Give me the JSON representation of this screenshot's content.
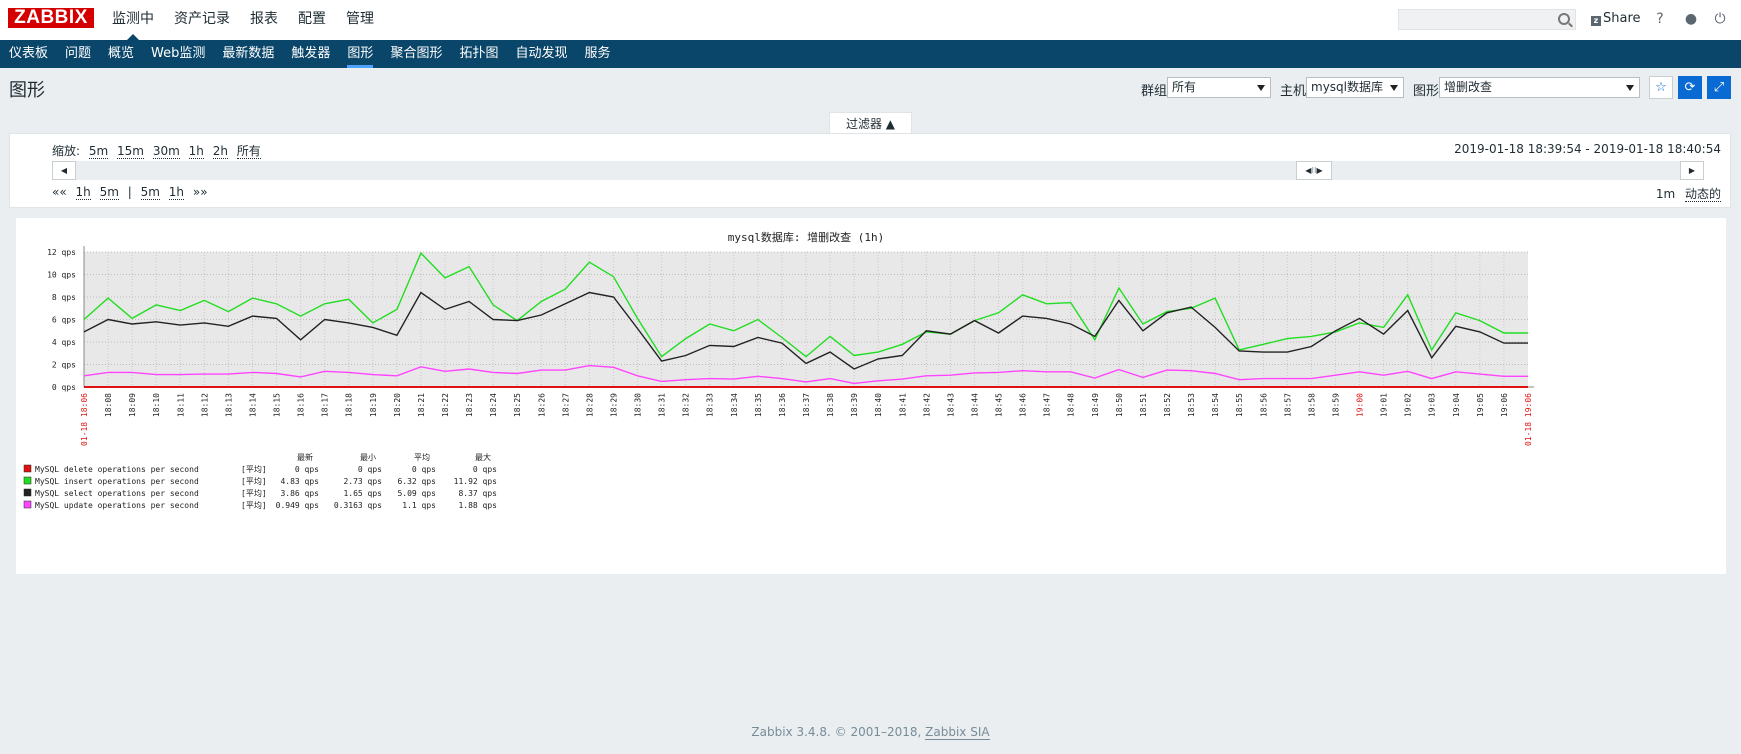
{
  "topbar": {
    "logo": "ZABBIX",
    "menu": [
      "监测中",
      "资产记录",
      "报表",
      "配置",
      "管理"
    ],
    "search_placeholder": "",
    "share_label": "Share",
    "share_icon": "z",
    "help_icon": "?",
    "user_icon": "●",
    "logout_icon": "⏻"
  },
  "mainnav": [
    "仪表板",
    "问题",
    "概览",
    "Web监测",
    "最新数据",
    "触发器",
    "图形",
    "聚合图形",
    "拓扑图",
    "自动发现",
    "服务"
  ],
  "page": {
    "title": "图形",
    "group_label": "群组",
    "group_value": "所有",
    "host_label": "主机",
    "host_value": "mysql数据库",
    "graph_label": "图形",
    "graph_value": "增删改查"
  },
  "filter": {
    "tab_label": "过滤器 ▲",
    "zoom_label": "缩放:",
    "zoom_options": [
      "5m",
      "15m",
      "30m",
      "1h",
      "2h",
      "所有"
    ],
    "range_text": "2019-01-18 18:39:54 - 2019-01-18 18:40:54",
    "back_label": "««",
    "back_options": [
      "1h",
      "5m"
    ],
    "separator": "|",
    "fwd_options": [
      "5m",
      "1h"
    ],
    "fwd_label": "»»",
    "period": "1m",
    "dynamic": "动态的"
  },
  "chart_data": {
    "type": "line",
    "title": "mysql数据库: 增删改查 (1h)",
    "unit": "qps",
    "ylim": [
      0,
      12
    ],
    "yticks": [
      "0 qps",
      "2 qps",
      "4 qps",
      "6 qps",
      "8 qps",
      "10 qps",
      "12 qps"
    ],
    "x_start_label": "01-18 18:06",
    "x_end_label": "01-18 19:06",
    "x_ticks": [
      "18:08",
      "18:09",
      "18:10",
      "18:11",
      "18:12",
      "18:13",
      "18:14",
      "18:15",
      "18:16",
      "18:17",
      "18:18",
      "18:19",
      "18:20",
      "18:21",
      "18:22",
      "18:23",
      "18:24",
      "18:25",
      "18:26",
      "18:27",
      "18:28",
      "18:29",
      "18:30",
      "18:31",
      "18:32",
      "18:33",
      "18:34",
      "18:35",
      "18:36",
      "18:37",
      "18:38",
      "18:39",
      "18:40",
      "18:41",
      "18:42",
      "18:43",
      "18:44",
      "18:45",
      "18:46",
      "18:47",
      "18:48",
      "18:49",
      "18:50",
      "18:51",
      "18:52",
      "18:53",
      "18:54",
      "18:55",
      "18:56",
      "18:57",
      "18:58",
      "18:59",
      "19:00",
      "19:01",
      "19:02",
      "19:03",
      "19:04",
      "19:05",
      "19:06"
    ],
    "grid": true,
    "series": [
      {
        "name": "MySQL delete operations per second",
        "color": "#e01010",
        "values": [
          0,
          0,
          0,
          0,
          0,
          0,
          0,
          0,
          0,
          0,
          0,
          0,
          0,
          0,
          0,
          0,
          0,
          0,
          0,
          0,
          0,
          0,
          0,
          0,
          0,
          0,
          0,
          0,
          0,
          0,
          0,
          0,
          0,
          0,
          0,
          0,
          0,
          0,
          0,
          0,
          0,
          0,
          0,
          0,
          0,
          0,
          0,
          0,
          0,
          0,
          0,
          0,
          0,
          0,
          0,
          0,
          0,
          0,
          0,
          0,
          0
        ]
      },
      {
        "name": "MySQL insert operations per second",
        "color": "#22dd22",
        "values": [
          6.0,
          7.9,
          6.1,
          7.3,
          6.8,
          7.7,
          6.7,
          7.9,
          7.4,
          6.3,
          7.4,
          7.8,
          5.7,
          6.9,
          11.9,
          9.7,
          10.7,
          7.3,
          5.9,
          7.6,
          8.7,
          11.1,
          9.8,
          6.1,
          2.7,
          4.3,
          5.6,
          5.0,
          6.0,
          4.4,
          2.7,
          4.5,
          2.8,
          3.1,
          3.8,
          4.9,
          4.7,
          5.9,
          6.6,
          8.2,
          7.4,
          7.5,
          4.2,
          8.8,
          5.6,
          6.7,
          7.0,
          7.9,
          3.3,
          3.8,
          4.3,
          4.5,
          4.9,
          5.7,
          5.3,
          8.2,
          3.3,
          6.6,
          5.9,
          4.8,
          4.8
        ]
      },
      {
        "name": "MySQL select operations per second",
        "color": "#222222",
        "values": [
          4.9,
          6.0,
          5.6,
          5.8,
          5.5,
          5.7,
          5.4,
          6.3,
          6.1,
          4.2,
          6.0,
          5.7,
          5.3,
          4.6,
          8.4,
          6.9,
          7.6,
          6.0,
          5.9,
          6.4,
          7.4,
          8.4,
          8.0,
          5.2,
          2.3,
          2.8,
          3.7,
          3.6,
          4.4,
          3.9,
          2.1,
          3.1,
          1.6,
          2.5,
          2.8,
          5.0,
          4.7,
          5.9,
          4.8,
          6.3,
          6.1,
          5.6,
          4.5,
          7.7,
          5.0,
          6.6,
          7.1,
          5.3,
          3.2,
          3.1,
          3.1,
          3.6,
          5.0,
          6.1,
          4.7,
          6.8,
          2.6,
          5.4,
          4.9,
          3.9,
          3.9
        ]
      },
      {
        "name": "MySQL update operations per second",
        "color": "#ff44ff",
        "values": [
          1.0,
          1.3,
          1.3,
          1.1,
          1.1,
          1.15,
          1.15,
          1.3,
          1.2,
          0.9,
          1.4,
          1.3,
          1.1,
          1.0,
          1.8,
          1.4,
          1.6,
          1.3,
          1.2,
          1.5,
          1.5,
          1.9,
          1.75,
          1.0,
          0.5,
          0.65,
          0.75,
          0.7,
          0.95,
          0.75,
          0.45,
          0.75,
          0.32,
          0.55,
          0.7,
          1.0,
          1.05,
          1.25,
          1.3,
          1.45,
          1.35,
          1.35,
          0.8,
          1.55,
          0.85,
          1.5,
          1.45,
          1.2,
          0.65,
          0.75,
          0.75,
          0.75,
          1.05,
          1.35,
          1.05,
          1.4,
          0.75,
          1.35,
          1.15,
          0.95,
          0.95
        ]
      }
    ],
    "legend": {
      "headers": [
        "最新",
        "最小",
        "平均",
        "最大"
      ],
      "tag": "[平均]",
      "rows": [
        {
          "name": "MySQL delete operations per second",
          "color": "#e01010",
          "last": "0 qps",
          "min": "0 qps",
          "avg": "0 qps",
          "max": "0 qps"
        },
        {
          "name": "MySQL insert operations per second",
          "color": "#22dd22",
          "last": "4.83 qps",
          "min": "2.73 qps",
          "avg": "6.32 qps",
          "max": "11.92 qps"
        },
        {
          "name": "MySQL select operations per second",
          "color": "#222222",
          "last": "3.86 qps",
          "min": "1.65 qps",
          "avg": "5.09 qps",
          "max": "8.37 qps"
        },
        {
          "name": "MySQL update operations per second",
          "color": "#ff44ff",
          "last": "0.949 qps",
          "min": "0.3163 qps",
          "avg": "1.1 qps",
          "max": "1.88 qps"
        }
      ]
    }
  },
  "footer": {
    "text": "Zabbix 3.4.8. © 2001–2018, ",
    "link": "Zabbix SIA"
  }
}
